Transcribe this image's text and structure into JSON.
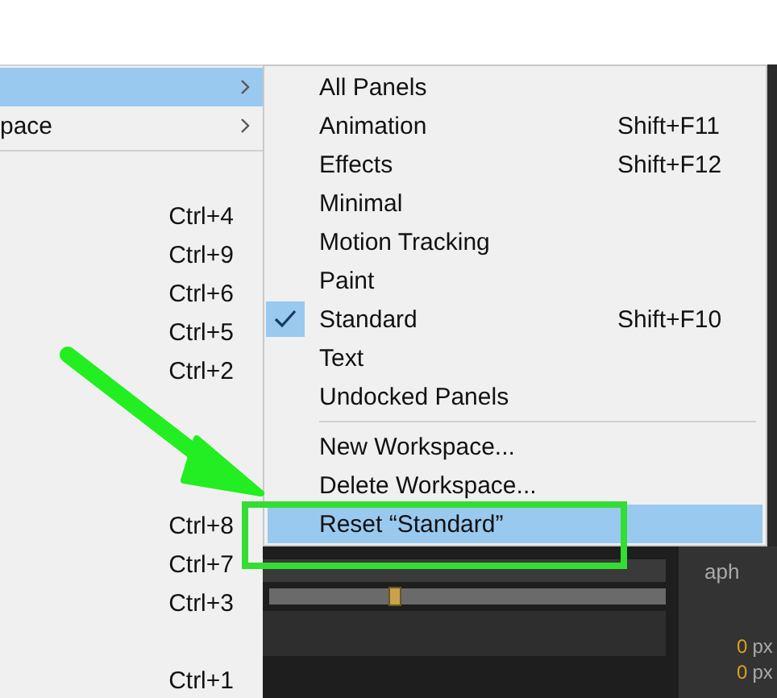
{
  "menu": {
    "items": [
      {
        "kind": "submenu",
        "selected": true
      },
      {
        "kind": "submenu",
        "label": "pace",
        "selected": false
      },
      {
        "kind": "separator"
      },
      {
        "kind": "gap"
      },
      {
        "kind": "item",
        "shortcut": "Ctrl+4",
        "selected": false
      },
      {
        "kind": "item",
        "shortcut": "Ctrl+9",
        "selected": false
      },
      {
        "kind": "item",
        "shortcut": "Ctrl+6",
        "selected": false
      },
      {
        "kind": "item",
        "shortcut": "Ctrl+5",
        "selected": false
      },
      {
        "kind": "item",
        "shortcut": "Ctrl+2",
        "selected": false
      },
      {
        "kind": "gap"
      },
      {
        "kind": "gap"
      },
      {
        "kind": "gap"
      },
      {
        "kind": "item",
        "shortcut": "Ctrl+8",
        "selected": false
      },
      {
        "kind": "item",
        "shortcut": "Ctrl+7",
        "selected": false
      },
      {
        "kind": "item",
        "shortcut": "Ctrl+3",
        "selected": false
      },
      {
        "kind": "gap"
      },
      {
        "kind": "item",
        "shortcut": "Ctrl+1",
        "selected": false
      }
    ]
  },
  "submenu": {
    "items": [
      {
        "kind": "item",
        "label": "All Panels",
        "checked": false,
        "selected": false
      },
      {
        "kind": "item",
        "label": "Animation",
        "shortcut": "Shift+F11",
        "checked": false,
        "selected": false
      },
      {
        "kind": "item",
        "label": "Effects",
        "shortcut": "Shift+F12",
        "checked": false,
        "selected": false
      },
      {
        "kind": "item",
        "label": "Minimal",
        "checked": false,
        "selected": false
      },
      {
        "kind": "item",
        "label": "Motion Tracking",
        "checked": false,
        "selected": false
      },
      {
        "kind": "item",
        "label": "Paint",
        "checked": false,
        "selected": false
      },
      {
        "kind": "item",
        "label": "Standard",
        "shortcut": "Shift+F10",
        "checked": true,
        "selected": false
      },
      {
        "kind": "item",
        "label": "Text",
        "checked": false,
        "selected": false
      },
      {
        "kind": "item",
        "label": "Undocked Panels",
        "checked": false,
        "selected": false
      },
      {
        "kind": "separator"
      },
      {
        "kind": "item",
        "label": "New Workspace...",
        "checked": false,
        "selected": false
      },
      {
        "kind": "item",
        "label": "Delete Workspace...",
        "checked": false,
        "selected": false
      },
      {
        "kind": "item",
        "label": "Reset “Standard”",
        "checked": false,
        "selected": true
      }
    ]
  },
  "panel": {
    "title": "aph",
    "rows": [
      {
        "value": "0",
        "unit": "px"
      },
      {
        "value": "0",
        "unit": "px"
      }
    ]
  }
}
